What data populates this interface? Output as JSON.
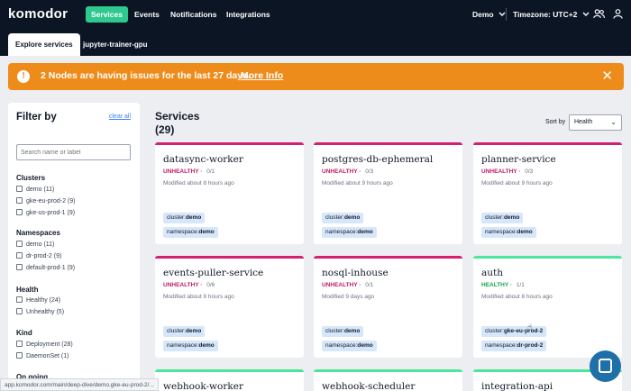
{
  "nav": {
    "logo": "komodor",
    "items": [
      "Services",
      "Events",
      "Notifications",
      "Integrations"
    ],
    "cluster": "Demo",
    "timezone": "Timezone: UTC+2"
  },
  "tabs": [
    "Explore services",
    "jupyter-trainer-gpu"
  ],
  "banner": {
    "message": "2 Nodes are having issues for the last 27 days.",
    "link": "More Info"
  },
  "filter": {
    "title": "Filter by",
    "clear": "clear all",
    "search_placeholder": "Search name or label",
    "groups": [
      {
        "title": "Clusters",
        "options": [
          "demo (11)",
          "gke-eu-prod-2 (9)",
          "gke-us-prod-1 (9)"
        ]
      },
      {
        "title": "Namespaces",
        "options": [
          "demo (11)",
          "dr-prod-2 (9)",
          "default-prod-1 (9)"
        ]
      },
      {
        "title": "Health",
        "options": [
          "Healthy (24)",
          "Unhealthy (5)"
        ]
      },
      {
        "title": "Kind",
        "options": [
          "Deployment (28)",
          "DaemonSet (1)"
        ]
      },
      {
        "title": "On going",
        "options": []
      }
    ]
  },
  "services": {
    "title": "Services",
    "count": "(29)",
    "sort_label": "Sort by",
    "sort_value": "Health",
    "cards": [
      {
        "name": "datasync-worker",
        "status": "UNHEALTHY",
        "count": "0/1",
        "modified": "Modified about 8 hours ago",
        "cluster_key": "cluster:",
        "cluster_val": "demo",
        "ns_key": "namespace:",
        "ns_val": "demo"
      },
      {
        "name": "postgres-db-ephemeral",
        "status": "UNHEALTHY",
        "count": "0/3",
        "modified": "Modified about 9 hours ago",
        "cluster_key": "cluster:",
        "cluster_val": "demo",
        "ns_key": "namespace:",
        "ns_val": "demo"
      },
      {
        "name": "planner-service",
        "status": "UNHEALTHY",
        "count": "0/3",
        "modified": "Modified about 9 hours ago",
        "cluster_key": "cluster:",
        "cluster_val": "demo",
        "ns_key": "namespace:",
        "ns_val": "demo"
      },
      {
        "name": "events-puller-service",
        "status": "UNHEALTHY",
        "count": "0/6",
        "modified": "Modified about 9 hours ago",
        "cluster_key": "cluster:",
        "cluster_val": "demo",
        "ns_key": "namespace:",
        "ns_val": "demo"
      },
      {
        "name": "nosql-inhouse",
        "status": "UNHEALTHY",
        "count": "0/1",
        "modified": "Modified 9 days ago",
        "cluster_key": "cluster:",
        "cluster_val": "demo",
        "ns_key": "namespace:",
        "ns_val": "demo"
      },
      {
        "name": "auth",
        "status": "HEALTHY",
        "count": "1/1",
        "modified": "Modified about 8 hours ago",
        "cluster_key": "cluster:",
        "cluster_val": "gke-eu-prod-2",
        "ns_key": "namespace:",
        "ns_val": "dr-prod-2"
      },
      {
        "name": "webhook-worker"
      },
      {
        "name": "webhook-scheduler"
      },
      {
        "name": "integration-api"
      }
    ]
  },
  "status_url": "app.komodor.com/main/deep-dive/demo.gke-eu-prod-2/..."
}
